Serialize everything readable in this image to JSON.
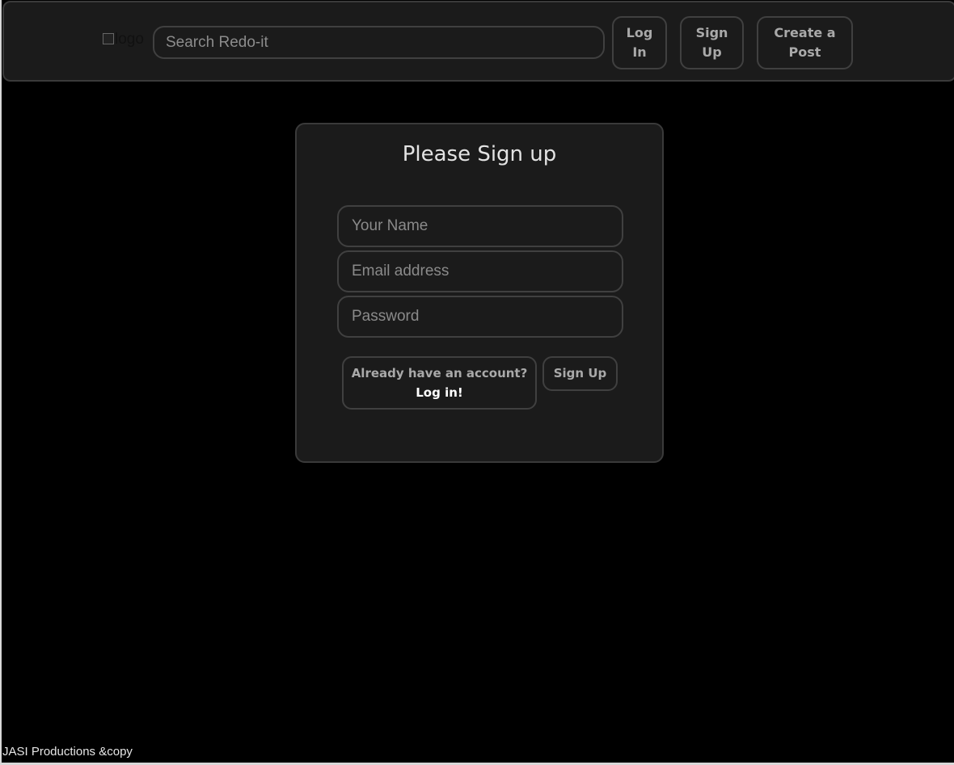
{
  "navbar": {
    "logo_alt": "logo",
    "search_placeholder": "Search Redo-it",
    "login_line1": "Log",
    "login_line2": "In",
    "signup_line1": "Sign",
    "signup_line2": "Up",
    "create_line1": "Create a",
    "create_line2": "Post"
  },
  "form": {
    "title": "Please Sign up",
    "name_placeholder": "Your Name",
    "email_placeholder": "Email address",
    "password_placeholder": "Password",
    "already_text": "Already have an account?",
    "login_link": "Log in!",
    "signup_button": "Sign Up"
  },
  "footer": {
    "text": "JASI Productions &copy"
  },
  "colors": {
    "background": "#000000",
    "panel": "#1b1b1b",
    "border": "#404040"
  }
}
